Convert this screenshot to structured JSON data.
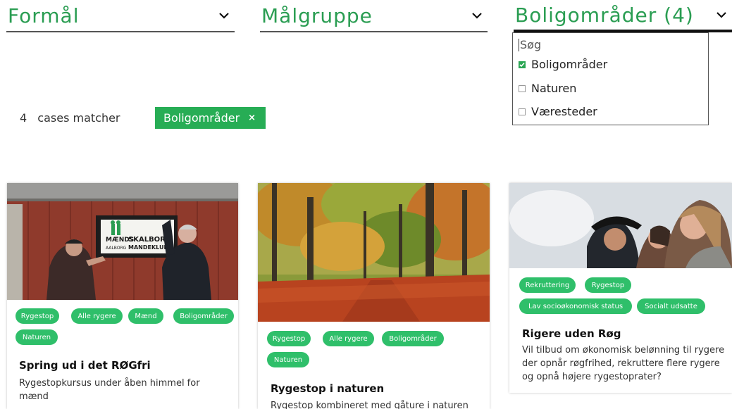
{
  "filters": {
    "formaal": {
      "label": "Formål"
    },
    "maalgruppe": {
      "label": "Målgruppe"
    },
    "boligomraader": {
      "label": "Boligområder (4)"
    }
  },
  "dropdown": {
    "search_placeholder": "Søg",
    "options": [
      {
        "label": "Boligområder",
        "checked": true
      },
      {
        "label": "Naturen",
        "checked": false
      },
      {
        "label": "Væresteder",
        "checked": false
      }
    ]
  },
  "results": {
    "count": "4",
    "text": "cases matcher"
  },
  "active_chip": {
    "label": "Boligområder",
    "remove": "×"
  },
  "cards": [
    {
      "tags": [
        "Rygestop",
        "Alle rygere",
        "Mænd",
        "Boligområder",
        "Naturen"
      ],
      "title": "Spring ud i det RØGfri",
      "description": "Rygestopkursus under åben himmel for mænd",
      "sign_text": [
        "MÆNDS",
        "SKALBORG",
        "AALBORG",
        "MANDEKLUB"
      ]
    },
    {
      "tags": [
        "Rygestop",
        "Alle rygere",
        "Boligområder",
        "Naturen"
      ],
      "title": "Rygestop i naturen",
      "description": "Rygestop kombineret med gåture i naturen"
    },
    {
      "tags": [
        "Rekruttering",
        "Rygestop",
        "Lav socioøkonomisk status",
        "Socialt udsatte"
      ],
      "title": "Rigere uden Røg",
      "description": "Vil tilbud om økonomisk belønning til rygere der opnår røgfrihed, rekruttere flere rygere og opnå højere rygestoprater?"
    }
  ],
  "colors": {
    "accent": "#2aa653",
    "tag": "#2fbf6a"
  }
}
